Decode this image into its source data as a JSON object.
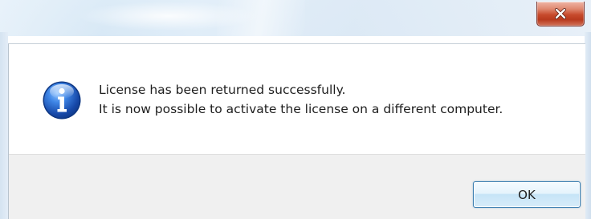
{
  "dialog": {
    "close_icon": "close-x-icon",
    "message_icon": "information-icon",
    "message_lines": [
      "License has been returned successfully.",
      "It is now possible to activate the license on a different computer."
    ],
    "ok_label": "OK"
  },
  "colors": {
    "close_button": "#c74a2c",
    "info_icon": "#1d58b5",
    "button_strip": "#f0f0f0",
    "ok_border": "#3c7fb1"
  }
}
